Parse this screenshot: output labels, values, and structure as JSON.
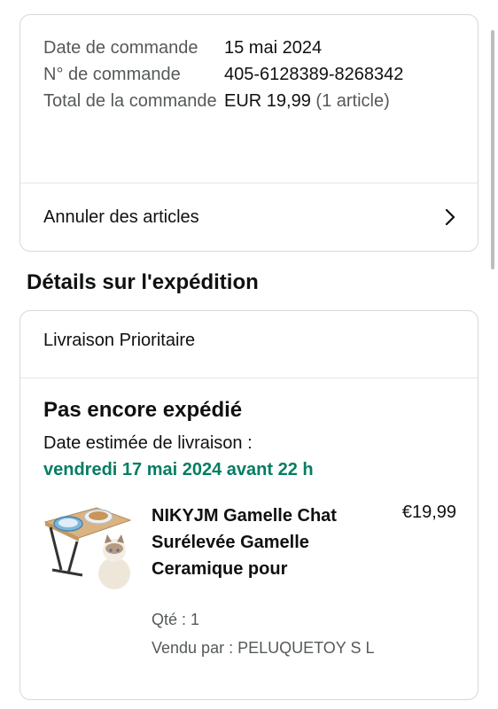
{
  "order": {
    "date_label": "Date de commande",
    "date_value": "15 mai 2024",
    "number_label": "N° de commande",
    "number_value": "405-6128389-8268342",
    "total_label": "Total de la commande",
    "total_value": "EUR 19,99",
    "total_items": "(1 article)",
    "cancel_label": "Annuler des articles"
  },
  "shipping": {
    "section_title": "Détails sur l'expédition",
    "method": "Livraison Prioritaire",
    "status": "Pas encore expédié",
    "estimate_label": "Date estimée de livraison :",
    "estimate_date": "vendredi 17 mai 2024 avant 22 h"
  },
  "product": {
    "title": "NIKYJM Gamelle Chat Surélevée Gamelle Ceramique pour",
    "price": "€19,99",
    "qty": "Qté : 1",
    "seller": "Vendu par : PELUQUETOY S L"
  },
  "colors": {
    "delivery_green": "#067d62",
    "border": "#d5d9d9",
    "muted_text": "#565959"
  },
  "icons": [
    "chevron-right-icon"
  ]
}
